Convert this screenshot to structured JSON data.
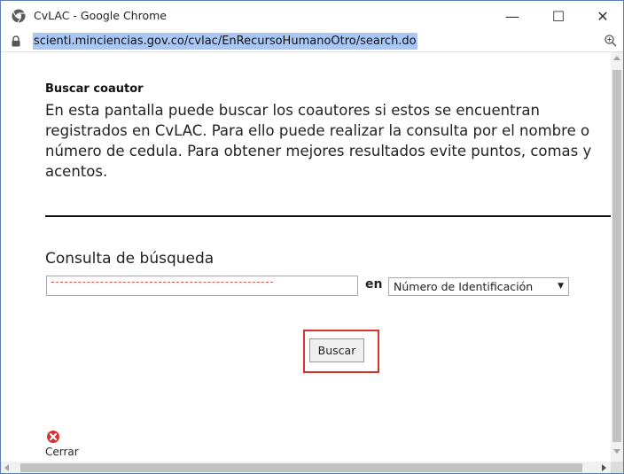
{
  "window": {
    "title": "CvLAC - Google Chrome",
    "minimize_glyph": "—",
    "maximize_glyph": "☐",
    "close_glyph": "✕"
  },
  "addressbar": {
    "url": "scienti.minciencias.gov.co/cvlac/EnRecursoHumanoOtro/search.do",
    "zoom_icon": "zoom-icon",
    "lock_icon": "lock-icon"
  },
  "page": {
    "heading": "Buscar coautor",
    "description": "En esta pantalla puede buscar los coautores si estos se encuentran registrados en CvLAC. Para ello puede realizar la consulta por el nombre o número de cedula. Para obtener mejores resultados evite puntos, comas y acentos.",
    "query_label": "Consulta de búsqueda",
    "query_value": "",
    "en_label": "en",
    "search_by_selected": "Número de Identificación",
    "search_button": "Buscar",
    "close_label": "Cerrar"
  },
  "colors": {
    "url_highlight": "#a9c7f5",
    "button_highlight_border": "#d93030",
    "close_icon": "#d9302f"
  }
}
